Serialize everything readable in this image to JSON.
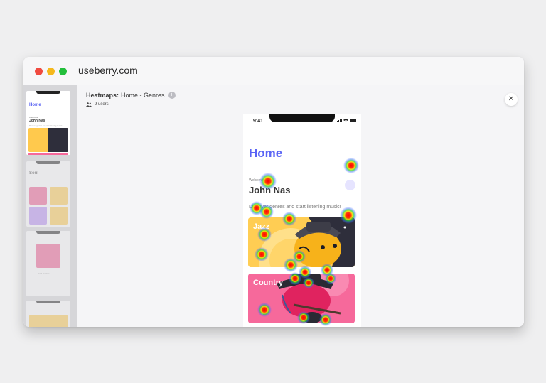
{
  "browser": {
    "url": "useberry.com",
    "traffic_lights": [
      "#f04a3f",
      "#f5b81c",
      "#23bf3b"
    ]
  },
  "thumbnails": {
    "screen1": {
      "title": "Home",
      "subtitle": "Welcome",
      "name": "John Nas",
      "line": "Discover genres and start listening music!"
    },
    "screen2": {
      "title": "Soul"
    },
    "screen3": {
      "title": "Soul Genres"
    }
  },
  "header": {
    "label": "Heatmaps:",
    "screen": "Home - Genres",
    "info_icon": "info-icon",
    "users": "9 users",
    "users_icon": "users-icon",
    "close_icon": "close-icon"
  },
  "phone": {
    "time": "9:41",
    "title": "Home",
    "sub": "Welcome",
    "name": "John Nas",
    "description": "Discover genres and start listening music!",
    "cards": [
      {
        "label": "Jazz",
        "color": "#ffcd53"
      },
      {
        "label": "Country",
        "color": "#f6699b"
      }
    ]
  },
  "colors": {
    "accent": "#5a64f5",
    "window_bg": "#ffffff",
    "page_bg": "#efeff0"
  }
}
